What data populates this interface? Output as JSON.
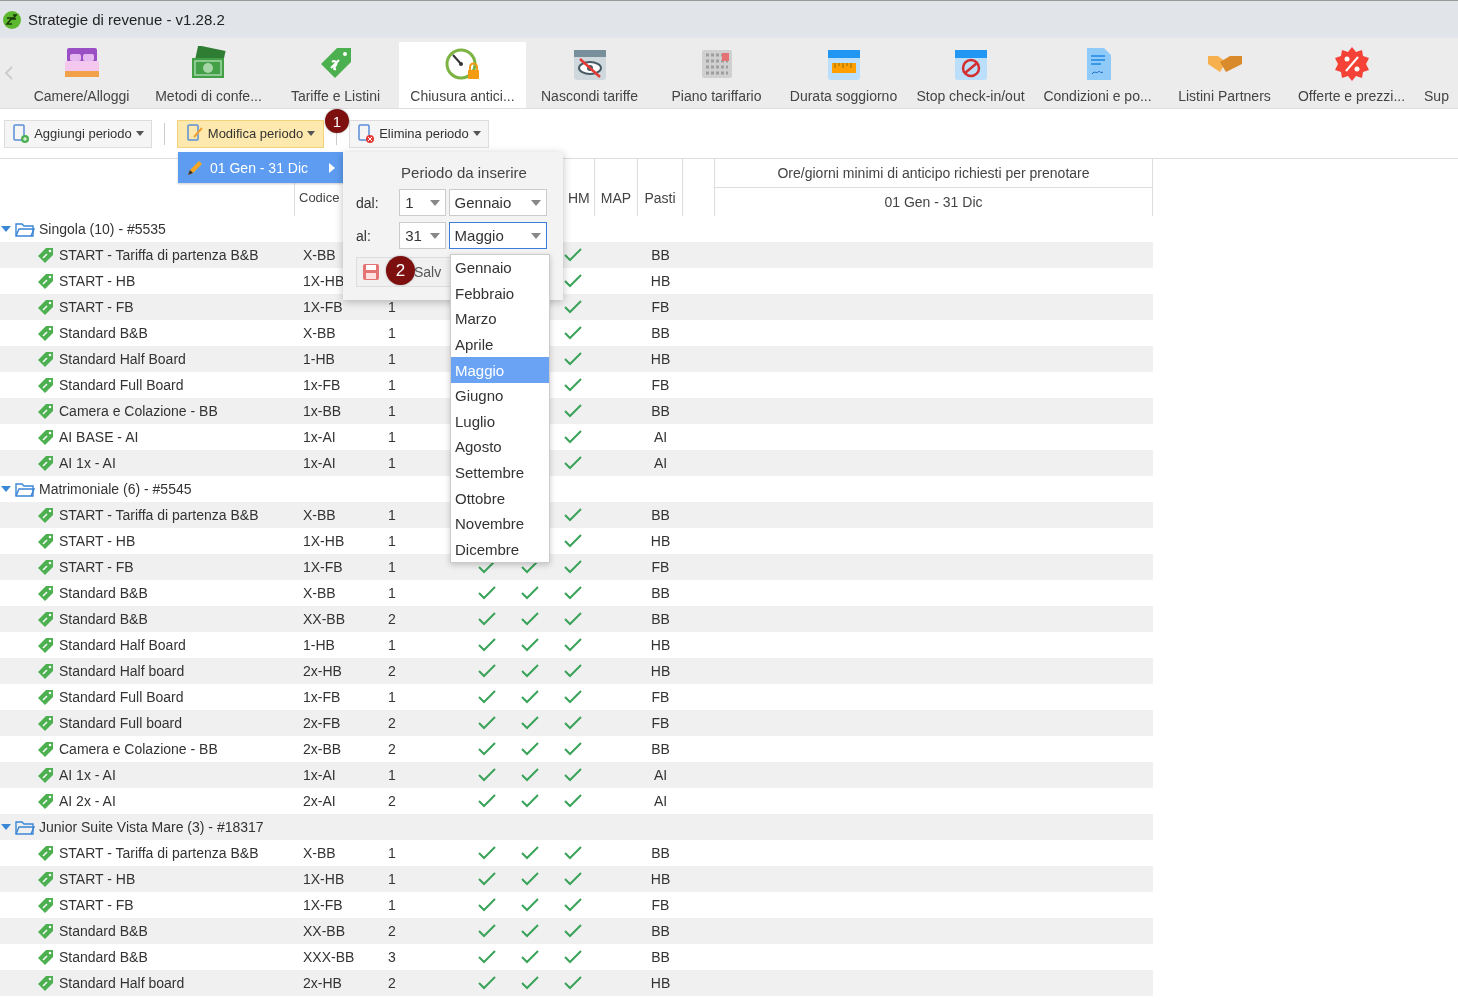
{
  "window": {
    "title": "Strategie di revenue - v1.28.2"
  },
  "tabs": [
    {
      "label": "Camere/Alloggi",
      "selected": false
    },
    {
      "label": "Metodi di confe...",
      "selected": false
    },
    {
      "label": "Tariffe e Listini",
      "selected": false
    },
    {
      "label": "Chiusura antici...",
      "selected": true
    },
    {
      "label": "Nascondi tariffe",
      "selected": false
    },
    {
      "label": "Piano tariffario",
      "selected": false
    },
    {
      "label": "Durata soggiorno",
      "selected": false
    },
    {
      "label": "Stop check-in/out",
      "selected": false
    },
    {
      "label": "Condizioni e po...",
      "selected": false
    },
    {
      "label": "Listini Partners",
      "selected": false
    },
    {
      "label": "Offerte e prezzi...",
      "selected": false
    },
    {
      "label": "Sup",
      "selected": false
    }
  ],
  "toolbar": [
    {
      "label": "Aggiungi periodo",
      "kind": "add",
      "selected": false
    },
    {
      "label": "Modifica periodo",
      "kind": "edit",
      "selected": true
    },
    {
      "label": "Elimina periodo",
      "kind": "delete",
      "selected": false
    }
  ],
  "step_badges": [
    "1",
    "2"
  ],
  "submenu": {
    "item": "01 Gen - 31 Dic"
  },
  "period_panel": {
    "title": "Periodo da inserire",
    "from_label": "dal:",
    "from_day": "1",
    "from_month": "Gennaio",
    "to_label": "al:",
    "to_day": "31",
    "to_month": "Maggio",
    "save": "Salv"
  },
  "month_list": [
    {
      "label": "Gennaio",
      "selected": false
    },
    {
      "label": "Febbraio",
      "selected": false
    },
    {
      "label": "Marzo",
      "selected": false
    },
    {
      "label": "Aprile",
      "selected": false
    },
    {
      "label": "Maggio",
      "selected": true
    },
    {
      "label": "Giugno",
      "selected": false
    },
    {
      "label": "Luglio",
      "selected": false
    },
    {
      "label": "Agosto",
      "selected": false
    },
    {
      "label": "Settembre",
      "selected": false
    },
    {
      "label": "Ottobre",
      "selected": false
    },
    {
      "label": "Novembre",
      "selected": false
    },
    {
      "label": "Dicembre",
      "selected": false
    }
  ],
  "table": {
    "columns": [
      "Codice",
      "HM",
      "MAP",
      "Pasti"
    ],
    "period_header": "Ore/giorni minimi di anticipo richiesti per prenotare",
    "period": "01 Gen - 31 Dic",
    "groups": [
      {
        "name": "Singola (10) - #5535",
        "expanded": true,
        "rows": [
          {
            "name": "START - Tariffa di partenza B&B",
            "code": "X-BB",
            "check_3": true,
            "meals": "BB"
          },
          {
            "name": "START - HB",
            "code": "1X-HB",
            "check_3": true,
            "meals": "HB"
          },
          {
            "name": "START - FB",
            "code": "1X-FB",
            "count": "1",
            "check_3": true,
            "meals": "FB"
          },
          {
            "name": "Standard B&B",
            "code": "X-BB",
            "count": "1",
            "check_3": true,
            "meals": "BB"
          },
          {
            "name": "Standard Half Board",
            "code": "1-HB",
            "count": "1",
            "check_3": true,
            "meals": "HB"
          },
          {
            "name": "Standard Full Board",
            "code": "1x-FB",
            "count": "1",
            "check_3": true,
            "meals": "FB"
          },
          {
            "name": "Camera e Colazione - BB",
            "code": "1x-BB",
            "count": "1",
            "check_3": true,
            "meals": "BB"
          },
          {
            "name": "AI BASE - AI",
            "code": "1x-AI",
            "count": "1",
            "check_3": true,
            "meals": "AI"
          },
          {
            "name": "AI 1x - AI",
            "code": "1x-AI",
            "count": "1",
            "check_3": true,
            "meals": "AI"
          }
        ]
      },
      {
        "name": "Matrimoniale (6) - #5545",
        "expanded": true,
        "rows": [
          {
            "name": "START - Tariffa di partenza B&B",
            "code": "X-BB",
            "count": "1",
            "check_3": true,
            "meals": "BB"
          },
          {
            "name": "START - HB",
            "code": "1X-HB",
            "count": "1",
            "check_3": true,
            "meals": "HB"
          },
          {
            "name": "START - FB",
            "code": "1X-FB",
            "count": "1",
            "check_1": true,
            "check_2": true,
            "check_3": true,
            "meals": "FB"
          },
          {
            "name": "Standard B&B",
            "code": "X-BB",
            "count": "1",
            "check_1": true,
            "check_2": true,
            "check_3": true,
            "meals": "BB"
          },
          {
            "name": "Standard B&B",
            "code": "XX-BB",
            "count": "2",
            "check_1": true,
            "check_2": true,
            "check_3": true,
            "meals": "BB"
          },
          {
            "name": "Standard Half Board",
            "code": "1-HB",
            "count": "1",
            "check_1": true,
            "check_2": true,
            "check_3": true,
            "meals": "HB"
          },
          {
            "name": "Standard Half board",
            "code": "2x-HB",
            "count": "2",
            "check_1": true,
            "check_2": true,
            "check_3": true,
            "meals": "HB"
          },
          {
            "name": "Standard Full Board",
            "code": "1x-FB",
            "count": "1",
            "check_1": true,
            "check_2": true,
            "check_3": true,
            "meals": "FB"
          },
          {
            "name": "Standard Full board",
            "code": "2x-FB",
            "count": "2",
            "check_1": true,
            "check_2": true,
            "check_3": true,
            "meals": "FB"
          },
          {
            "name": "Camera e Colazione - BB",
            "code": "2x-BB",
            "count": "2",
            "check_1": true,
            "check_2": true,
            "check_3": true,
            "meals": "BB"
          },
          {
            "name": "AI 1x - AI",
            "code": "1x-AI",
            "count": "1",
            "check_1": true,
            "check_2": true,
            "check_3": true,
            "meals": "AI"
          },
          {
            "name": "AI 2x - AI",
            "code": "2x-AI",
            "count": "2",
            "check_1": true,
            "check_2": true,
            "check_3": true,
            "meals": "AI"
          }
        ]
      },
      {
        "name": "Junior Suite Vista Mare (3) - #18317",
        "expanded": true,
        "rows": [
          {
            "name": "START - Tariffa di partenza B&B",
            "code": "X-BB",
            "count": "1",
            "check_1": true,
            "check_2": true,
            "check_3": true,
            "meals": "BB"
          },
          {
            "name": "START - HB",
            "code": "1X-HB",
            "count": "1",
            "check_1": true,
            "check_2": true,
            "check_3": true,
            "meals": "HB"
          },
          {
            "name": "START - FB",
            "code": "1X-FB",
            "count": "1",
            "check_1": true,
            "check_2": true,
            "check_3": true,
            "meals": "FB"
          },
          {
            "name": "Standard B&B",
            "code": "XX-BB",
            "count": "2",
            "check_1": true,
            "check_2": true,
            "check_3": true,
            "meals": "BB"
          },
          {
            "name": "Standard B&B",
            "code": "XXX-BB",
            "count": "3",
            "check_1": true,
            "check_2": true,
            "check_3": true,
            "meals": "BB"
          },
          {
            "name": "Standard Half board",
            "code": "2x-HB",
            "count": "2",
            "check_1": true,
            "check_2": true,
            "check_3": true,
            "meals": "HB"
          }
        ]
      }
    ]
  }
}
